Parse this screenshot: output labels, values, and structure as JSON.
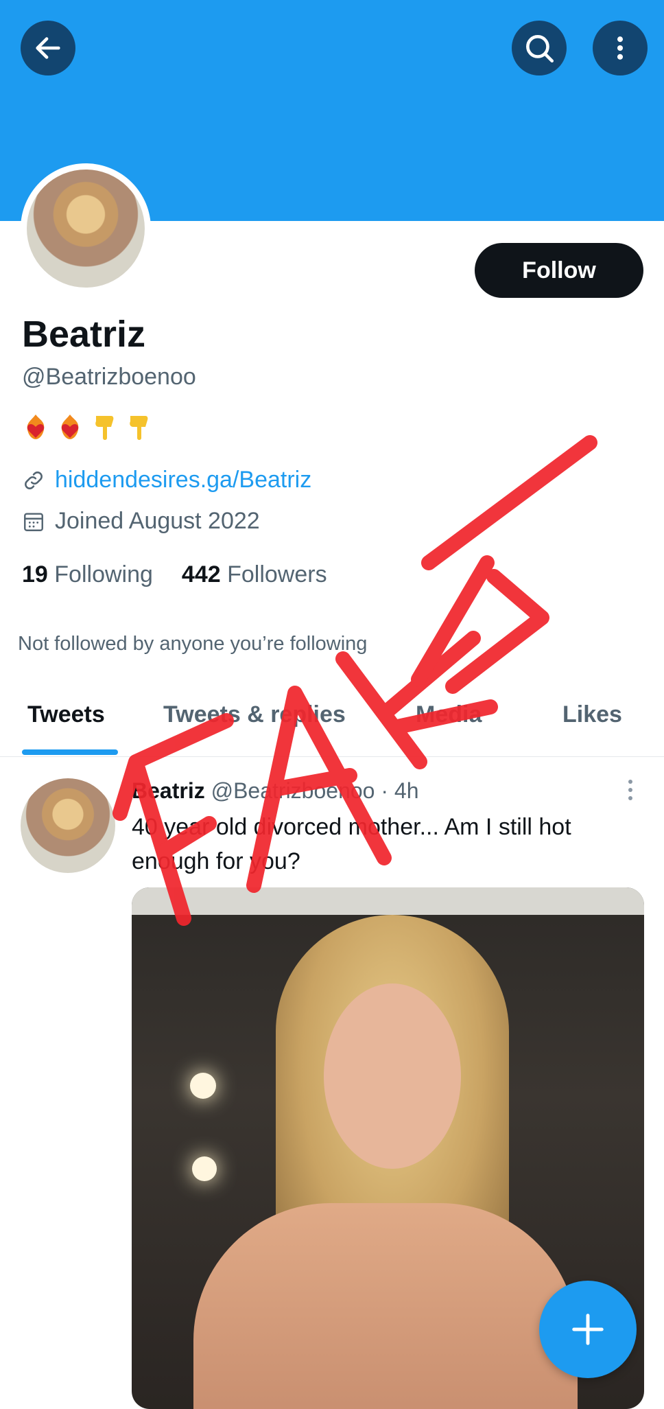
{
  "header": {
    "back_icon": "arrow-left-icon",
    "search_icon": "search-icon",
    "more_icon": "more-vertical-icon",
    "banner_color": "#1d9bf0"
  },
  "profile": {
    "follow_label": "Follow",
    "name": "Beatriz",
    "handle": "@Beatrizboenoo",
    "bio_emojis": [
      "fire-heart-emoji",
      "fire-heart-emoji",
      "pointing-down-emoji",
      "pointing-down-emoji"
    ],
    "website": "hiddendesires.ga/Beatriz",
    "joined": "Joined August 2022",
    "following_count": "19",
    "following_label": "Following",
    "followers_count": "442",
    "followers_label": "Followers",
    "not_followed_text": "Not followed by anyone you’re following"
  },
  "tabs": [
    {
      "label": "Tweets",
      "active": true
    },
    {
      "label": "Tweets & replies",
      "active": false
    },
    {
      "label": "Media",
      "active": false
    },
    {
      "label": "Likes",
      "active": false
    }
  ],
  "tweet": {
    "name": "Beatriz",
    "handle": "@Beatrizboenoo",
    "separator": "·",
    "time": "4h",
    "text": "40 year old divorced mother... Am I still hot enough for you?"
  },
  "overlay": {
    "text": "FAKE",
    "color": "#f0262d"
  },
  "fab_icon": "plus-icon"
}
